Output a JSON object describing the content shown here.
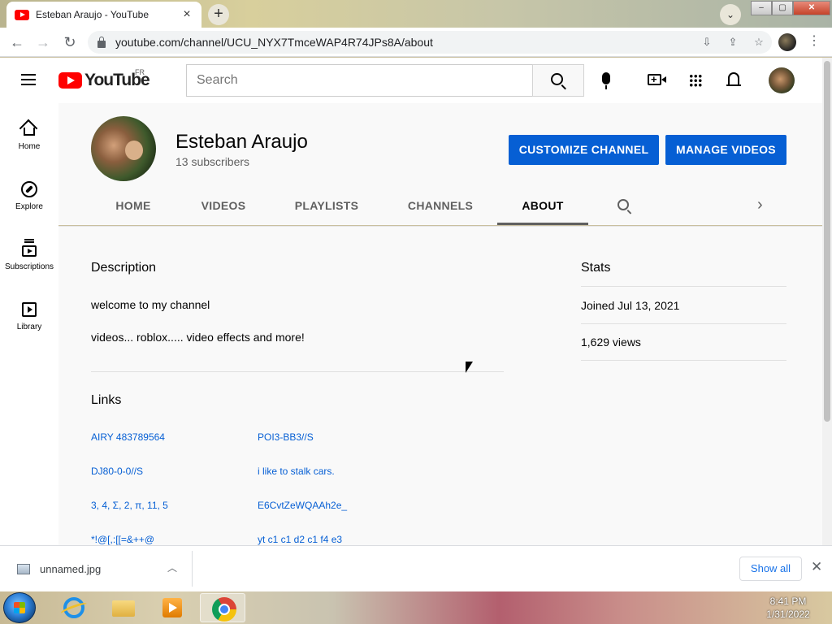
{
  "browser": {
    "tab_title": "Esteban Araujo - YouTube",
    "url": "youtube.com/channel/UCU_NYX7TmceWAP4R74JPs8A/about"
  },
  "youtube": {
    "logo_text": "YouTube",
    "country_code": "FR",
    "search_placeholder": "Search"
  },
  "sidebar": {
    "items": [
      {
        "label": "Home"
      },
      {
        "label": "Explore"
      },
      {
        "label": "Subscriptions"
      },
      {
        "label": "Library"
      }
    ]
  },
  "channel": {
    "name": "Esteban Araujo",
    "subscribers": "13 subscribers",
    "customize_label": "CUSTOMIZE CHANNEL",
    "manage_label": "MANAGE VIDEOS",
    "tabs": [
      {
        "label": "HOME"
      },
      {
        "label": "VIDEOS"
      },
      {
        "label": "PLAYLISTS"
      },
      {
        "label": "CHANNELS"
      },
      {
        "label": "ABOUT"
      }
    ],
    "active_tab": "ABOUT"
  },
  "about": {
    "description_heading": "Description",
    "description_lines": [
      "welcome to my channel",
      "videos... roblox..... video effects and more!"
    ],
    "links_heading": "Links",
    "links": [
      "AIRY 483789564",
      "POI3-BB3//S",
      "DJ80-0-0//S",
      "i like to stalk cars.",
      "3, 4, Σ, 2, π, 11, 5",
      "E6CvtZeWQAAh2e_",
      "*!@[,:[[=&++@",
      "yt c1 c1 d2 c1 f4 e3"
    ],
    "stats_heading": "Stats",
    "joined": "Joined Jul 13, 2021",
    "views": "1,629 views"
  },
  "downloads": {
    "file": "unnamed.jpg",
    "show_all": "Show all"
  },
  "taskbar": {
    "time": "8:41 PM",
    "date": "1/31/2022"
  }
}
